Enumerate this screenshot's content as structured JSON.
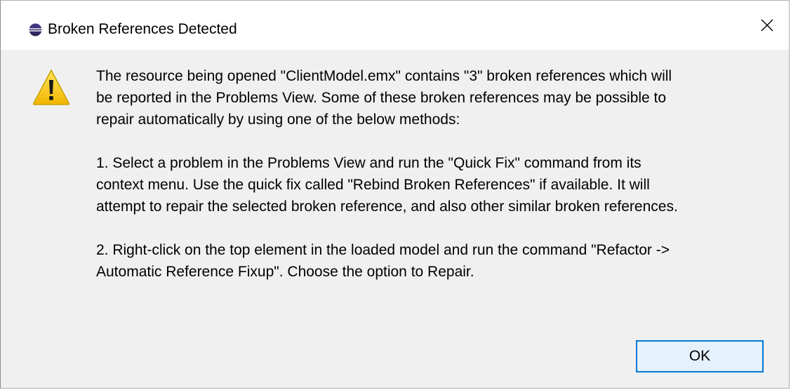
{
  "window": {
    "title": "Broken References Detected",
    "app_icon": "eclipse-icon",
    "close_icon": "close-icon"
  },
  "message": {
    "icon": "warning-icon",
    "paragraph_1": "The resource being opened \"ClientModel.emx\" contains \"3\" broken references which will\nbe reported in the Problems View. Some of these broken references may be possible to\nrepair automatically by using one of the below methods:",
    "paragraph_2": "1. Select a problem in the Problems View and run the \"Quick Fix\" command from its\ncontext menu. Use the quick fix called \"Rebind Broken References\" if available. It will\nattempt to repair the selected broken reference, and also other similar broken references.",
    "paragraph_3": "2. Right-click on the top element in the loaded model and run the command \"Refactor ->\nAutomatic Reference Fixup\". Choose the option to Repair."
  },
  "buttons": {
    "ok_label": "OK"
  },
  "colors": {
    "dialog_background": "#f0f0f0",
    "titlebar_background": "#ffffff",
    "button_border": "#0078d7",
    "button_background": "#e5f1fb"
  }
}
